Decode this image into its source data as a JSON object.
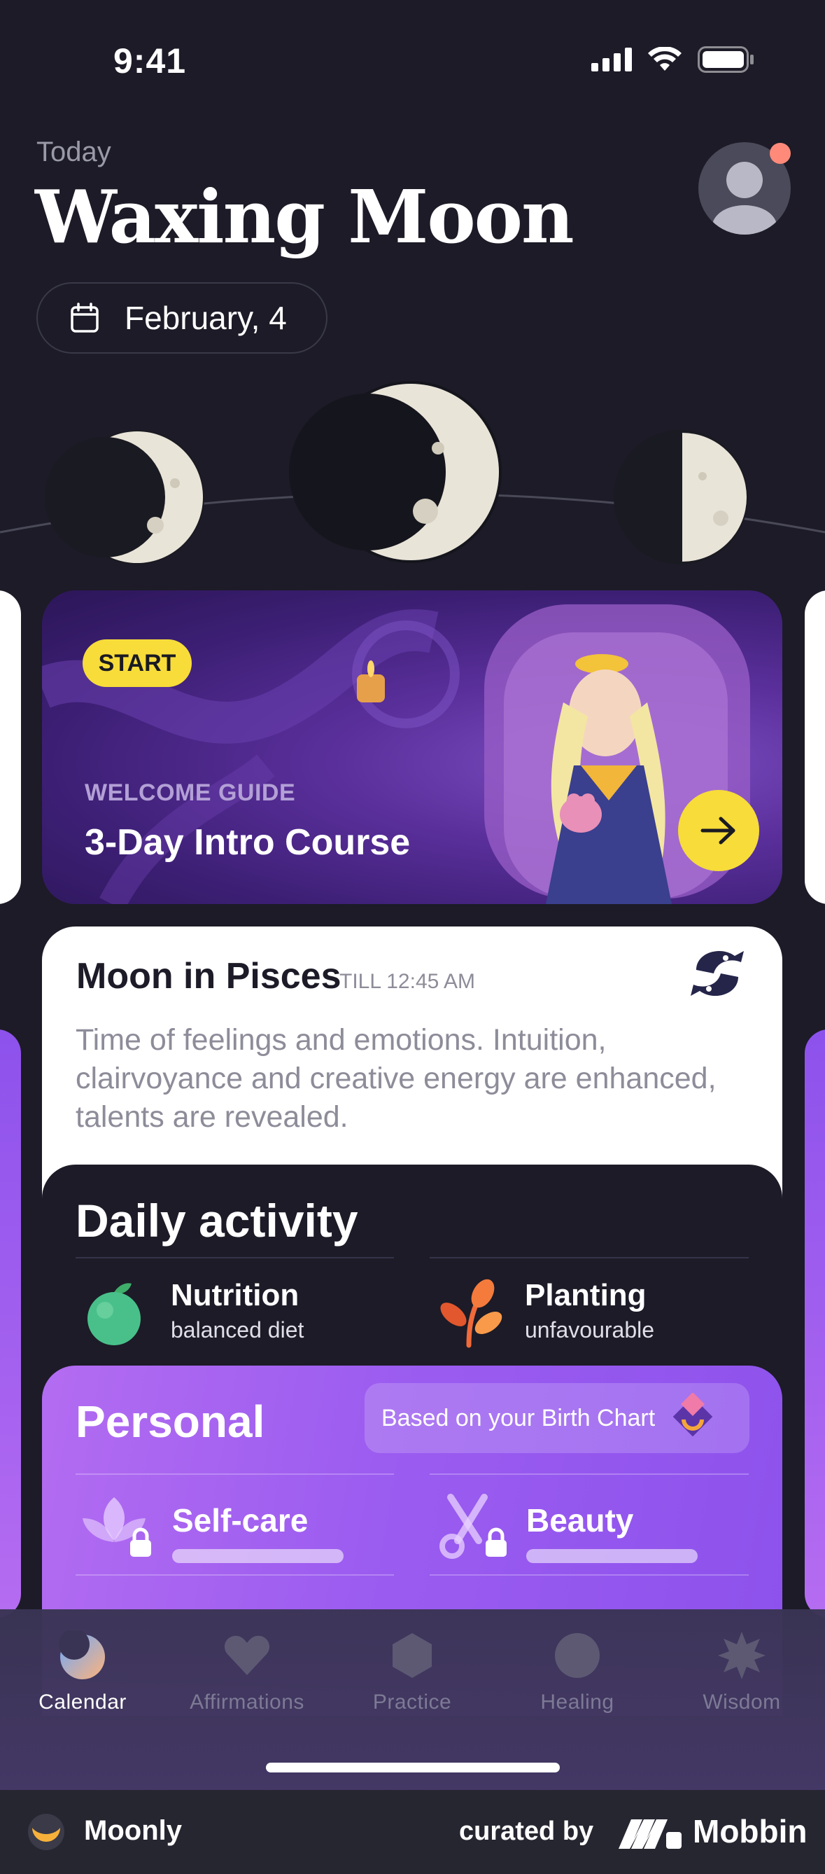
{
  "status_bar": {
    "time": "9:41"
  },
  "header": {
    "today_label": "Today",
    "title": "Waxing Moon",
    "date": "February, 4"
  },
  "course": {
    "badge": "START",
    "label": "WELCOME GUIDE",
    "title": "3-Day Intro Course"
  },
  "moon_sign": {
    "title": "Moon in Pisces",
    "till": "TILL 12:45 AM",
    "description": "Time of feelings and emotions. Intuition, clairvoyance and creative energy are enhanced, talents are revealed."
  },
  "daily_activity": {
    "title": "Daily activity",
    "items": [
      {
        "name": "Nutrition",
        "status": "balanced diet",
        "icon": "apple-icon"
      },
      {
        "name": "Planting",
        "status": "unfavourable",
        "icon": "leaf-icon"
      }
    ]
  },
  "personal": {
    "title": "Personal",
    "birth_chart": "Based on your Birth Chart",
    "items": [
      {
        "name": "Self-care",
        "icon": "lotus-icon",
        "locked": true
      },
      {
        "name": "Beauty",
        "icon": "scissors-icon",
        "locked": true
      }
    ]
  },
  "tabs": [
    {
      "label": "Calendar",
      "icon": "moon-icon",
      "active": true
    },
    {
      "label": "Affirmations",
      "icon": "heart-icon",
      "active": false
    },
    {
      "label": "Practice",
      "icon": "hexagon-icon",
      "active": false
    },
    {
      "label": "Healing",
      "icon": "circle-icon",
      "active": false
    },
    {
      "label": "Wisdom",
      "icon": "star-burst-icon",
      "active": false
    }
  ],
  "footer": {
    "app_name": "Moonly",
    "curated_by": "curated by",
    "brand": "Mobbin"
  },
  "colors": {
    "background": "#1c1b27",
    "accent_yellow": "#f7dc3a",
    "accent_purple": "#9b5cf0",
    "notification_dot": "#ff8a7a"
  }
}
